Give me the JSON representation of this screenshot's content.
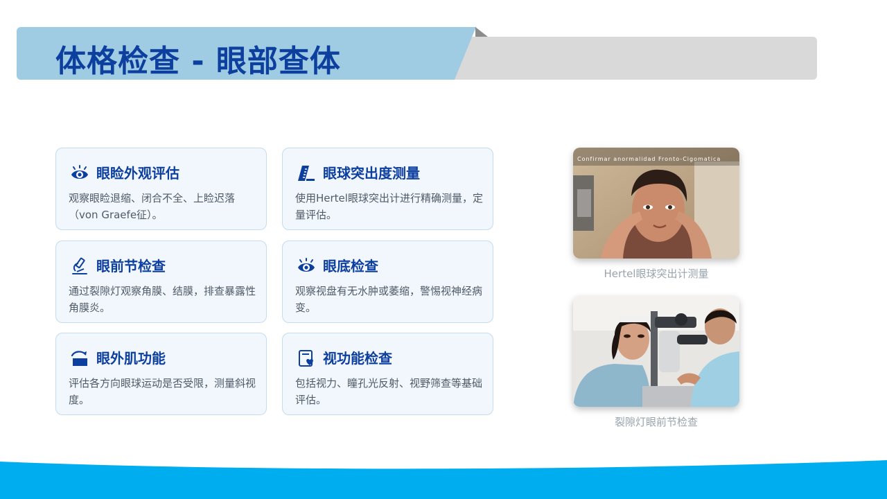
{
  "header": {
    "title": "体格检查 - 眼部查体"
  },
  "cards": [
    {
      "icon": "eye-icon",
      "title": "眼睑外观评估",
      "desc": "观察眼睑退缩、闭合不全、上睑迟落（von Graefe征）。"
    },
    {
      "icon": "ruler-icon",
      "title": "眼球突出度测量",
      "desc": "使用Hertel眼球突出计进行精确测量，定量评估。"
    },
    {
      "icon": "microscope-icon",
      "title": "眼前节检查",
      "desc": "通过裂隙灯观察角膜、结膜，排查暴露性角膜炎。"
    },
    {
      "icon": "eye-icon",
      "title": "眼底检查",
      "desc": "观察视盘有无水肿或萎缩，警惕视神经病变。"
    },
    {
      "icon": "eyelid-icon",
      "title": "眼外肌功能",
      "desc": "评估各方向眼球运动是否受限，测量斜视度。"
    },
    {
      "icon": "document-heart-icon",
      "title": "视功能检查",
      "desc": "包括视力、瞳孔光反射、视野筛查等基础评估。"
    }
  ],
  "photos": [
    {
      "overlay": "Confirmar anormalidad Fronto-Cigomatica",
      "caption": "Hertel眼球突出计测量"
    },
    {
      "caption": "裂隙灯眼前节检查"
    }
  ],
  "colors": {
    "accent": "#0d3f9e",
    "banner": "#9fcbe3",
    "footer": "#00aeef"
  }
}
